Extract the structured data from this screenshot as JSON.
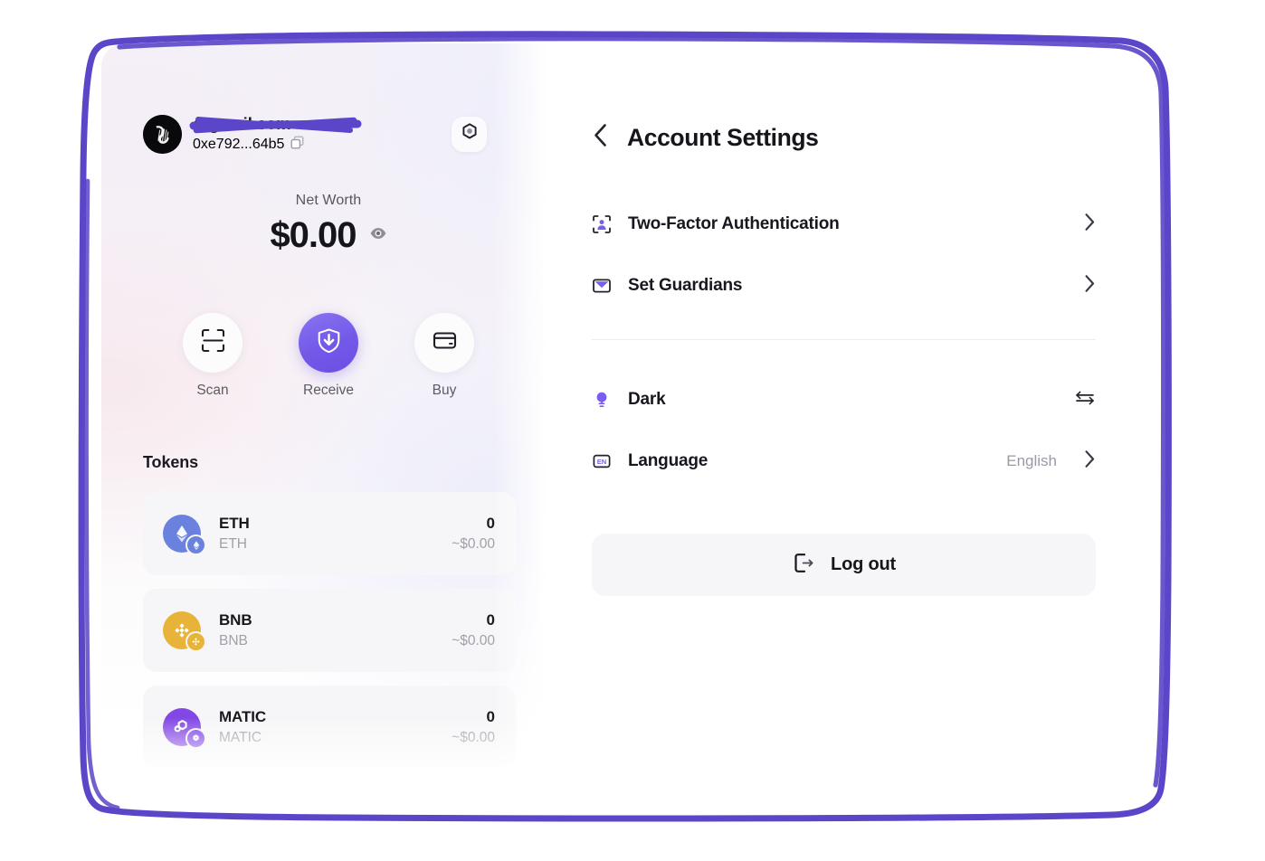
{
  "wallet": {
    "account": {
      "email": "@gmail.com",
      "email_redacted": true,
      "address": "0xe792...64b5",
      "copy_icon": "copy-icon",
      "avatar_icon": "avatar-image",
      "settings_icon": "hexagon-nut-icon"
    },
    "net_worth": {
      "label": "Net Worth",
      "value": "$0.00",
      "visibility_icon": "eye-icon"
    },
    "actions": [
      {
        "label": "Scan",
        "icon": "scan-qr-icon",
        "primary": false
      },
      {
        "label": "Receive",
        "icon": "receive-download-shield-icon",
        "primary": true
      },
      {
        "label": "Buy",
        "icon": "credit-card-icon",
        "primary": false
      }
    ],
    "tokens_title": "Tokens",
    "tokens": [
      {
        "symbol": "ETH",
        "name": "ETH",
        "amount": "0",
        "fiat": "~$0.00",
        "color": "#6a82dd",
        "icon": "ethereum-icon"
      },
      {
        "symbol": "BNB",
        "name": "BNB",
        "amount": "0",
        "fiat": "~$0.00",
        "color": "#e8b339",
        "icon": "binance-icon"
      },
      {
        "symbol": "MATIC",
        "name": "MATIC",
        "amount": "0",
        "fiat": "~$0.00",
        "color": "#8247e5",
        "icon": "polygon-icon"
      }
    ]
  },
  "settings": {
    "back_icon": "chevron-left-icon",
    "title": "Account Settings",
    "group_security": [
      {
        "label": "Two-Factor Authentication",
        "icon": "two-factor-person-frame-icon",
        "value": "",
        "trailing": "chevron-right-icon"
      },
      {
        "label": "Set Guardians",
        "icon": "envelope-guardian-icon",
        "value": "",
        "trailing": "chevron-right-icon"
      }
    ],
    "group_preferences": [
      {
        "label": "Dark",
        "icon": "lightbulb-icon",
        "value": "",
        "trailing": "swap-arrows-icon"
      },
      {
        "label": "Language",
        "icon": "language-en-icon",
        "value": "English",
        "trailing": "chevron-right-icon"
      }
    ],
    "logout_label": "Log out",
    "logout_icon": "logout-icon"
  },
  "theme": {
    "accent": "#6b4fe4",
    "annotation_stroke": "#5b45c8",
    "text_primary": "#15151c",
    "text_muted": "#9a9aa4",
    "surface": "#f6f6f8"
  }
}
